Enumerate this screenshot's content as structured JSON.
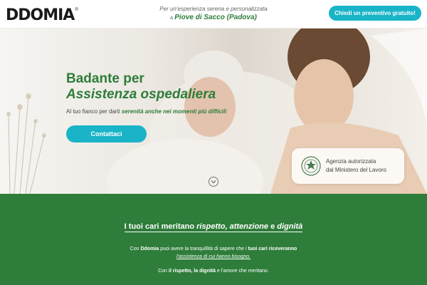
{
  "header": {
    "logo": "DDOMIA",
    "tagline_line1": "Per un'esperienza serena e personalizzata",
    "location_prefix": "a",
    "location": "Piove di Sacco (Padova)",
    "cta_label": "Chiedi un preventivo gratuito!"
  },
  "hero": {
    "title_line1": "Badante per",
    "title_line2": "Assistenza ospedaliera",
    "subtitle_prefix": "Al tuo fianco per darti",
    "subtitle_emphasis": "serenità anche nei momenti più difficili",
    "cta_label": "Contattaci",
    "agency_line1": "Agenzia autorizzata",
    "agency_line2": "dal Ministero del Lavoro"
  },
  "mission": {
    "title_a": "I tuoi cari meritano",
    "title_b": "rispetto, attenzione",
    "title_c": "e",
    "title_d": "dignità",
    "p1_a": "Con",
    "p1_brand": "Ddomia",
    "p1_b": "puoi avere la tranquillità di sapere che i",
    "p1_c": "tuoi cari riceveranno",
    "p1_d": "l'assistenza di cui hanno bisogno.",
    "p2_a": "Con",
    "p2_b": "il rispetto, la dignità",
    "p2_c": "e l'amore che meritano."
  },
  "colors": {
    "brand_green": "#2e7d3a",
    "cta_cyan": "#1ab4c8"
  },
  "icons": {
    "scroll": "chevron-down-icon",
    "emblem": "italian-republic-emblem-icon"
  }
}
